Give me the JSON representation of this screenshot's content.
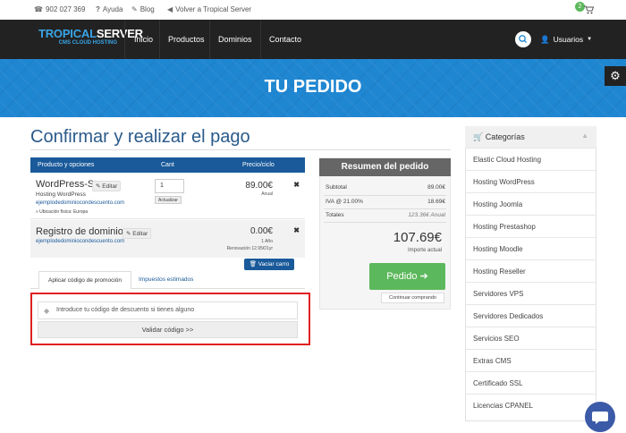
{
  "topbar": {
    "phone": "902 027 369",
    "help": "Ayuda",
    "blog": "Blog",
    "back": "Volver a Tropical Server",
    "cart_count": "2"
  },
  "nav": {
    "logo_main_1": "TROPICAL",
    "logo_main_2": "SERVER",
    "logo_sub": "CMS CLOUD HOSTING",
    "links": [
      "Inicio",
      "Productos",
      "Dominios",
      "Contacto"
    ],
    "users": "Usuarios"
  },
  "banner": {
    "title": "TU PEDIDO"
  },
  "page": {
    "title": "Confirmar y realizar el pago"
  },
  "cart": {
    "headers": {
      "product": "Producto y opciones",
      "qty": "Cant",
      "price": "Precio/ciclo"
    },
    "item1": {
      "name": "WordPress-S",
      "edit": "Editar",
      "type": "Hosting WordPress",
      "domain": "ejemplodedominiocondescuento.com",
      "location": "» Ubicación física: Europa",
      "qty": "1",
      "update": "Actualizar",
      "price": "89.00€",
      "cycle": "Anual"
    },
    "item2": {
      "name": "Registro de dominio",
      "edit": "Editar",
      "domain": "ejemplodedominiocondescuento.com",
      "price": "0.00€",
      "cycle": "1 Año",
      "renewal": "Renovación 12.95€/1yr"
    },
    "empty": "Vaciar carro"
  },
  "tabs": {
    "promo": "Aplicar código de promoción",
    "taxes": "Impuestos estimados"
  },
  "promo": {
    "placeholder": "Introduce tu código de descuento si tienes alguno",
    "validate": "Validar código >>"
  },
  "summary": {
    "title": "Resumen del pedido",
    "subtotal_label": "Subtotal",
    "subtotal": "89.00€",
    "tax_label": "IVA @ 21.00%",
    "tax": "18.69€",
    "totals_label": "Totales",
    "totals": "123.36€ Anual",
    "total": "107.69€",
    "total_label": "Importe actual",
    "order": "Pedido",
    "continue": "Continuar comprando"
  },
  "categories": {
    "title": "Categorías",
    "items": [
      "Elastic Cloud Hosting",
      "Hosting WordPress",
      "Hosting Joomla",
      "Hosting Prestashop",
      "Hosting Moodle",
      "Hosting Reseller",
      "Servidores VPS",
      "Servidores Dedicados",
      "Servicios SEO",
      "Extras CMS",
      "Certificado SSL",
      "Licencias CPANEL"
    ]
  }
}
